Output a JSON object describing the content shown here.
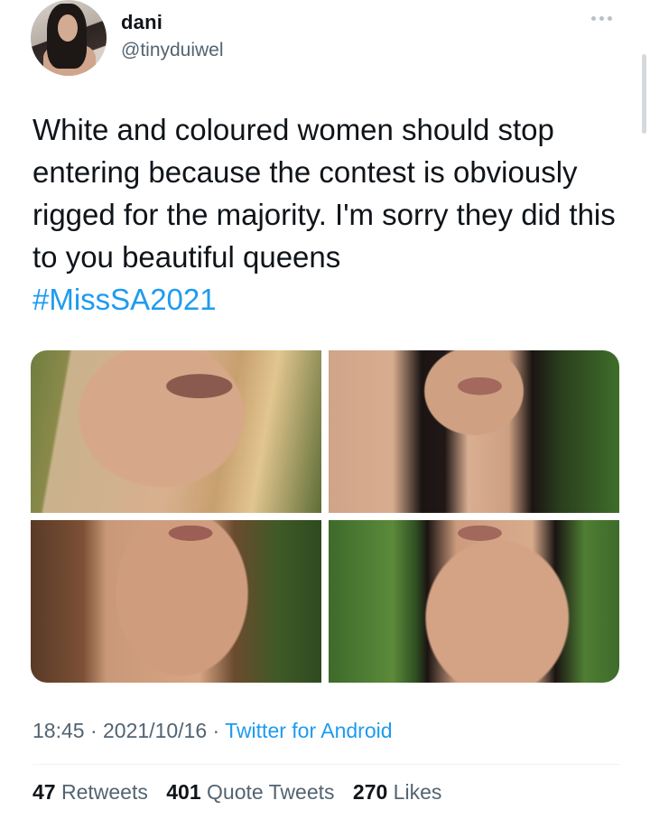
{
  "author": {
    "display_name": "dani",
    "handle": "@tinyduiwel"
  },
  "tweet": {
    "text": "White and coloured women should stop entering because the contest is obviously rigged for the majority. I'm sorry they did this to you beautiful queens",
    "hashtag": "#MissSA2021"
  },
  "media": [
    {
      "id": "photo-1"
    },
    {
      "id": "photo-2"
    },
    {
      "id": "photo-3"
    },
    {
      "id": "photo-4"
    }
  ],
  "meta": {
    "time": "18:45",
    "separator": " · ",
    "date": "2021/10/16",
    "separator2": " · ",
    "source": "Twitter for Android"
  },
  "stats": {
    "retweets_count": "47",
    "retweets_label": "Retweets",
    "quotes_count": "401",
    "quotes_label": "Quote Tweets",
    "likes_count": "270",
    "likes_label": "Likes"
  },
  "colors": {
    "accent": "#1d9bf0",
    "text": "#0f1419",
    "secondary": "#536471"
  },
  "icons": {
    "more": "more-horizontal-icon"
  }
}
